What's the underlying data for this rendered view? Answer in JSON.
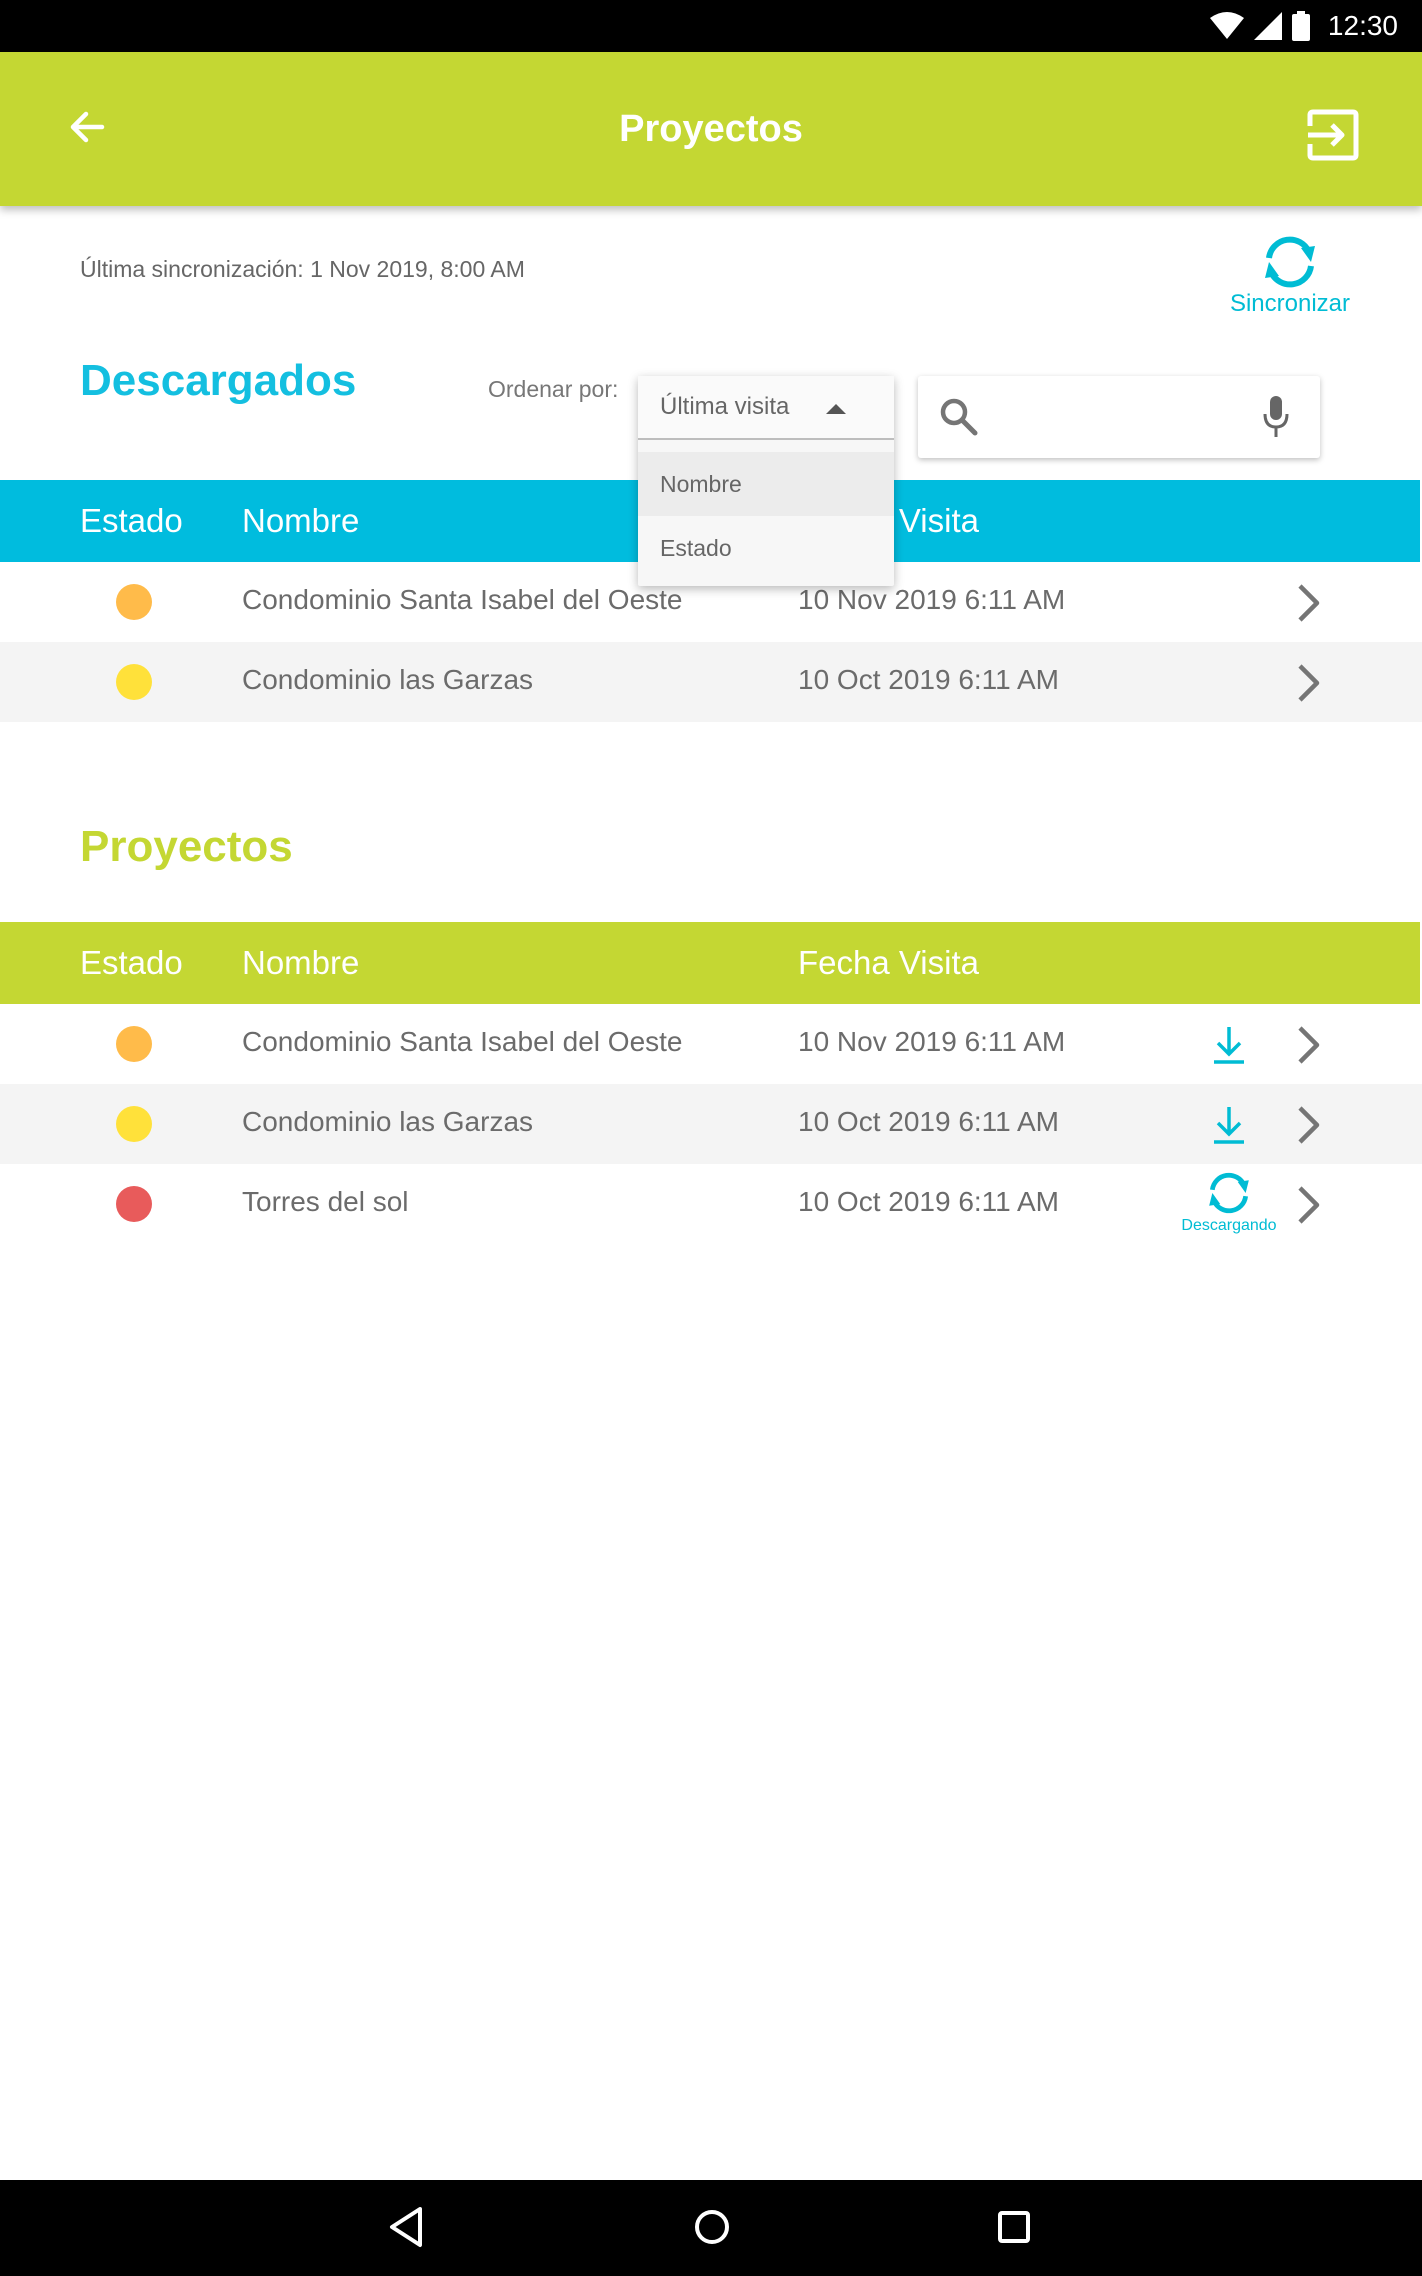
{
  "status_bar": {
    "time": "12:30"
  },
  "app_bar": {
    "title": "Proyectos",
    "back_icon": "arrow-left-icon",
    "exit_icon": "exit-to-app-icon"
  },
  "sync": {
    "last_sync": "Última sincronización: 1 Nov 2019, 8:00 AM",
    "button_label": "Sincronizar"
  },
  "downloaded": {
    "title": "Descargados",
    "order_label": "Ordenar por:",
    "order_selected": "Última visita",
    "order_options": [
      "Nombre",
      "Estado"
    ],
    "search": {
      "placeholder": ""
    },
    "headers": {
      "estado": "Estado",
      "nombre": "Nombre",
      "fecha": "Fecha Visita"
    },
    "rows": [
      {
        "status_color": "#ffbb4a",
        "name": "Condominio Santa Isabel del Oeste",
        "date": "10 Nov 2019 6:11 AM"
      },
      {
        "status_color": "#ffe13a",
        "name": "Condominio las Garzas",
        "date": "10 Oct 2019 6:11 AM"
      }
    ]
  },
  "projects": {
    "title": "Proyectos",
    "headers": {
      "estado": "Estado",
      "nombre": "Nombre",
      "fecha": "Fecha Visita"
    },
    "rows": [
      {
        "status_color": "#ffbb4a",
        "name": "Condominio Santa Isabel del Oeste",
        "date": "10 Nov 2019 6:11 AM",
        "action": "download"
      },
      {
        "status_color": "#ffe13a",
        "name": "Condominio las Garzas",
        "date": "10 Oct 2019 6:11 AM",
        "action": "download"
      },
      {
        "status_color": "#e85b5b",
        "name": "Torres del sol",
        "date": "10 Oct 2019 6:11 AM",
        "action": "downloading",
        "action_label": "Descargando"
      }
    ]
  },
  "colors": {
    "primary": "#c4d733",
    "accent": "#00bcde"
  }
}
